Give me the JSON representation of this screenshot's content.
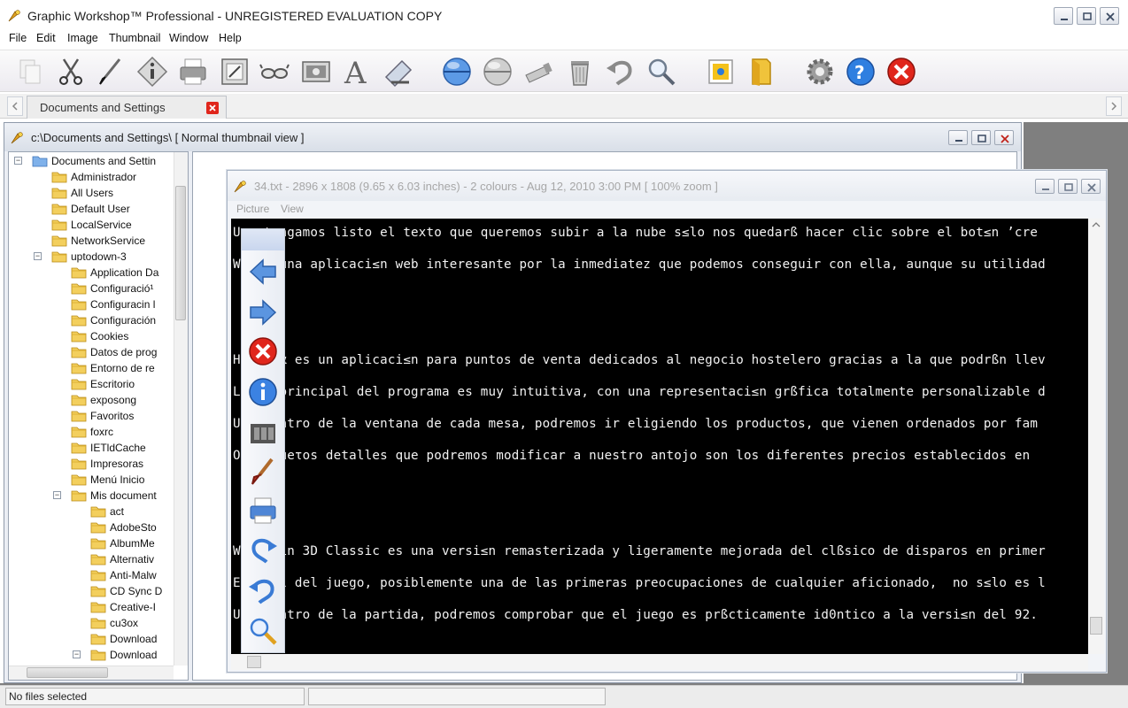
{
  "app": {
    "title": "Graphic Workshop™ Professional - UNREGISTERED EVALUATION COPY"
  },
  "menubar": {
    "items": [
      "File",
      "Edit",
      "Image",
      "Thumbnail",
      "Window",
      "Help"
    ]
  },
  "toolbar": {
    "icons": [
      "copy-icon",
      "cut-icon",
      "brush-icon",
      "info-icon",
      "print-icon",
      "crop-icon",
      "glasses-icon",
      "image-icon",
      "text-icon",
      "scanner-icon",
      "sphere-blue-icon",
      "sphere-gray-icon",
      "tube-icon",
      "trash-icon",
      "undo-icon",
      "zoom-icon",
      "picture-frame-icon",
      "folder-icon",
      "settings-icon",
      "help-icon",
      "exit-icon"
    ]
  },
  "tabs": {
    "active_label": "Documents and Settings"
  },
  "browser": {
    "title": "c:\\Documents and Settings\\  [ Normal thumbnail view  ]"
  },
  "tree": {
    "items": [
      {
        "label": "Documents and Settin",
        "level": 0,
        "expander": "−"
      },
      {
        "label": "Administrador",
        "level": 1
      },
      {
        "label": "All Users",
        "level": 1
      },
      {
        "label": "Default User",
        "level": 1
      },
      {
        "label": "LocalService",
        "level": 1
      },
      {
        "label": "NetworkService",
        "level": 1
      },
      {
        "label": "uptodown-3",
        "level": 1,
        "expander": "−"
      },
      {
        "label": "Application Da",
        "level": 2
      },
      {
        "label": "Configuració¹",
        "level": 2
      },
      {
        "label": "Configuracin l",
        "level": 2
      },
      {
        "label": "Configuración",
        "level": 2
      },
      {
        "label": "Cookies",
        "level": 2
      },
      {
        "label": "Datos de prog",
        "level": 2
      },
      {
        "label": "Entorno de re",
        "level": 2
      },
      {
        "label": "Escritorio",
        "level": 2
      },
      {
        "label": "exposong",
        "level": 2
      },
      {
        "label": "Favoritos",
        "level": 2
      },
      {
        "label": "foxrc",
        "level": 2
      },
      {
        "label": "IETldCache",
        "level": 2
      },
      {
        "label": "Impresoras",
        "level": 2
      },
      {
        "label": "Menú Inicio",
        "level": 2
      },
      {
        "label": "Mis document",
        "level": 2,
        "expander": "−"
      },
      {
        "label": "act",
        "level": 3
      },
      {
        "label": "AdobeSto",
        "level": 3
      },
      {
        "label": "AlbumMe",
        "level": 3
      },
      {
        "label": "Alternativ",
        "level": 3
      },
      {
        "label": "Anti-Malw",
        "level": 3
      },
      {
        "label": "CD Sync D",
        "level": 3
      },
      {
        "label": "Creative-I",
        "level": 3
      },
      {
        "label": "cu3ox",
        "level": 3
      },
      {
        "label": "Download",
        "level": 3
      },
      {
        "label": "Download",
        "level": 3,
        "expander": "−"
      }
    ]
  },
  "viewer": {
    "title": "34.txt - 2896 x 1808 (9.65 x 6.03 inches) - 2 colours - Aug 12, 2010 3:00 PM  [ 100% zoom ]",
    "menu": [
      "Picture",
      "View"
    ],
    "lines": [
      {
        "text": "Una tengamos listo el texto que queremos subir a la nube s≤lo nos quedarß hacer clic sobre el bot≤n ’cre",
        "row": 0
      },
      {
        "text": "Wr  s una aplicaci≤n web interesante por la inmediatez que podemos conseguir con ella, aunque su utilidad",
        "row": 1
      },
      {
        "text": "Hc  rgα es un aplicaci≤n para puntos de venta dedicados al negocio hostelero gracias a la que podrßn llev",
        "row": 4
      },
      {
        "text": "La  a principal del programa es muy intuitiva, con una representaci≤n grßfica totalmente personalizable d",
        "row": 5
      },
      {
        "text": "Ur  dentro de la ventana de cada mesa, podremos ir eligiendo los productos, que vienen ordenados por fam",
        "row": 6
      },
      {
        "text": "Ot  equeτos detalles que podremos modificar a nuestro antojo son los diferentes precios establecidos en",
        "row": 7
      },
      {
        "text": "We  tein 3D Classic es una versi≤n remasterizada y ligeramente mejorada del clßsico de disparos en primer",
        "row": 10
      },
      {
        "text": "El  rol del juego, posiblemente una de las primeras preocupaciones de cualquier aficionado,  no s≤lo es l",
        "row": 11
      },
      {
        "text": "Ur  dentro de la partida, podremos comprobar que el juego es prßcticamente id0ntico a la versi≤n del 92.",
        "row": 12
      }
    ]
  },
  "palette": {
    "tools": [
      "back-arrow-icon",
      "forward-arrow-icon",
      "close-red-icon",
      "info-icon",
      "film-icon",
      "brush-icon",
      "print-icon",
      "redo-icon",
      "undo-icon",
      "zoom-icon"
    ]
  },
  "status": {
    "text": "No files selected"
  },
  "colors": {
    "accent_red": "#e0261c",
    "accent_blue": "#2a6fd0",
    "canvas": "#000000"
  }
}
